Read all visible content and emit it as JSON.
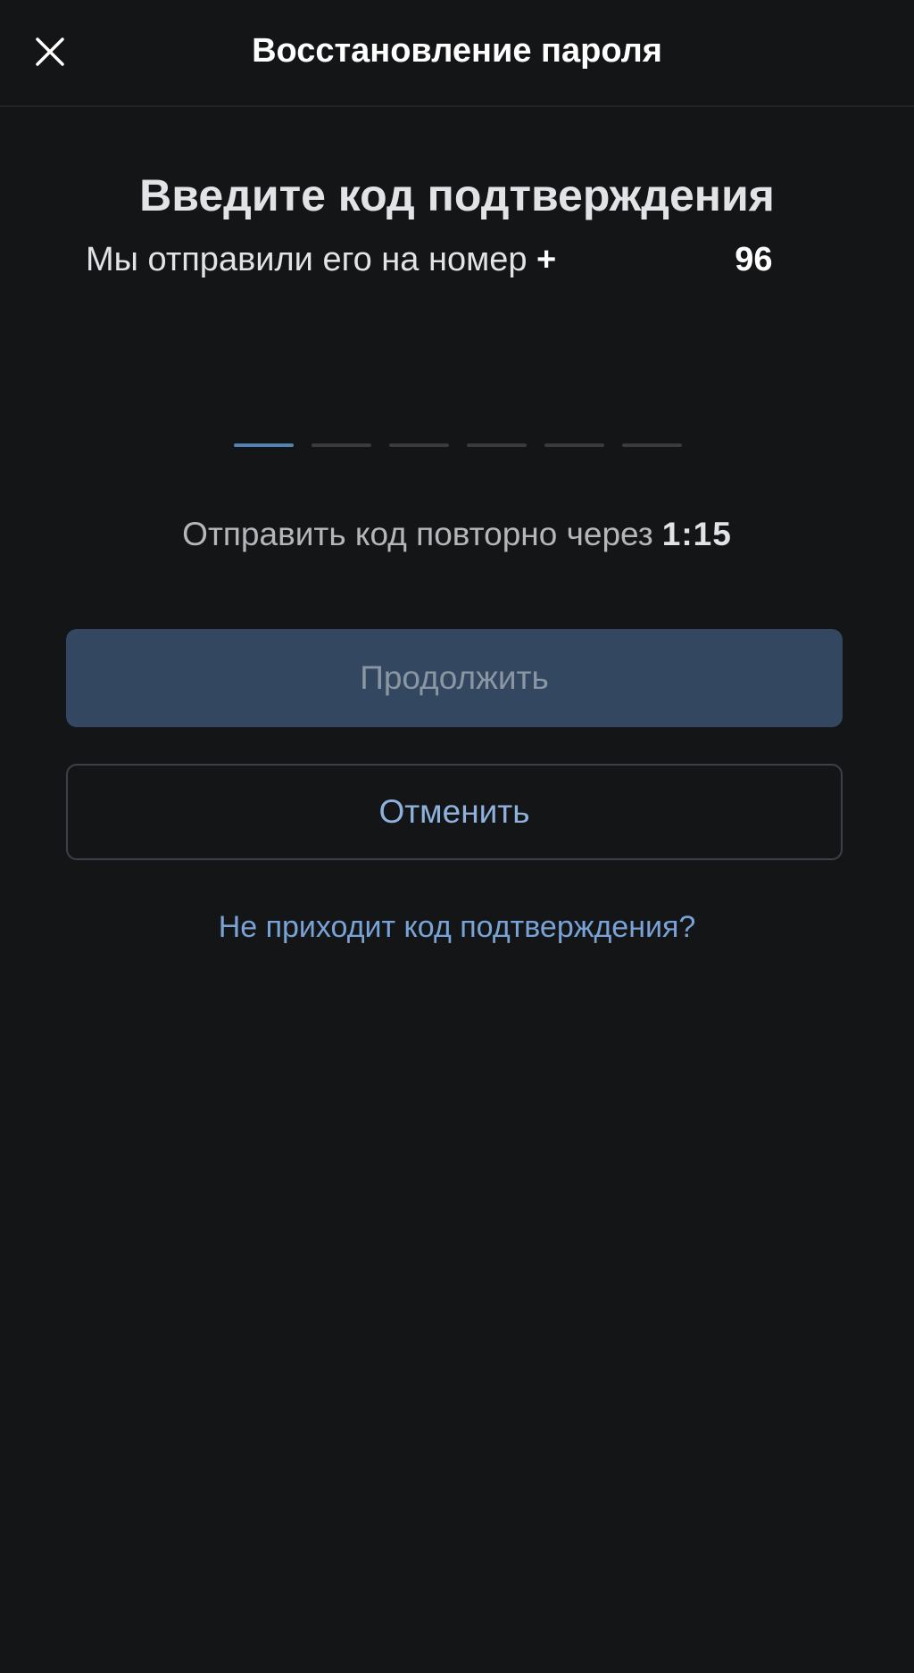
{
  "header": {
    "title": "Восстановление пароля",
    "close_icon": "close-icon"
  },
  "main": {
    "title": "Введите код подтверждения",
    "subtitle_text": "Мы отправили его на номер ",
    "phone_prefix": "+",
    "phone_suffix": "96",
    "code_length": 6,
    "active_slot_index": 0,
    "resend_text": "Отправить код повторно через",
    "resend_timer": "1:15"
  },
  "buttons": {
    "continue_label": "Продолжить",
    "cancel_label": "Отменить"
  },
  "links": {
    "no_code": "Не приходит код подтверждения?"
  },
  "colors": {
    "background": "#141517",
    "accent": "#5582b5",
    "continue_bg": "#334860",
    "link": "#79a3d6"
  }
}
